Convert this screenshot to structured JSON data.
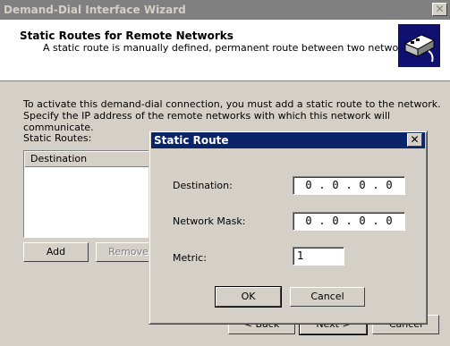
{
  "wizard": {
    "title": "Demand-Dial Interface Wizard",
    "close_glyph": "✕",
    "header_title": "Static Routes for Remote Networks",
    "header_subtitle": "A static route is manually defined, permanent route between two networks.",
    "header_icon": "network-route-icon",
    "instructions": "To activate this demand-dial connection, you must add a static route to the network. Specify the IP address of the remote networks with which this network will communicate.",
    "static_routes_label": "Static Routes:",
    "column_destination": "Destination",
    "add_button": "Add",
    "remove_button": "Remove",
    "back_button": "< Back",
    "next_button": "Next >",
    "cancel_button": "Cancel"
  },
  "dialog": {
    "title": "Static Route",
    "close_glyph": "✕",
    "destination_label": "Destination:",
    "destination_octets": [
      "0",
      "0",
      "0",
      "0"
    ],
    "mask_label": "Network Mask:",
    "mask_octets": [
      "0",
      "0",
      "0",
      "0"
    ],
    "metric_label": "Metric:",
    "metric_value": "1",
    "ok_button": "OK",
    "cancel_button": "Cancel"
  },
  "colors": {
    "active_title": "#0a246a",
    "inactive_title": "#808080",
    "face": "#d4d0c8"
  }
}
